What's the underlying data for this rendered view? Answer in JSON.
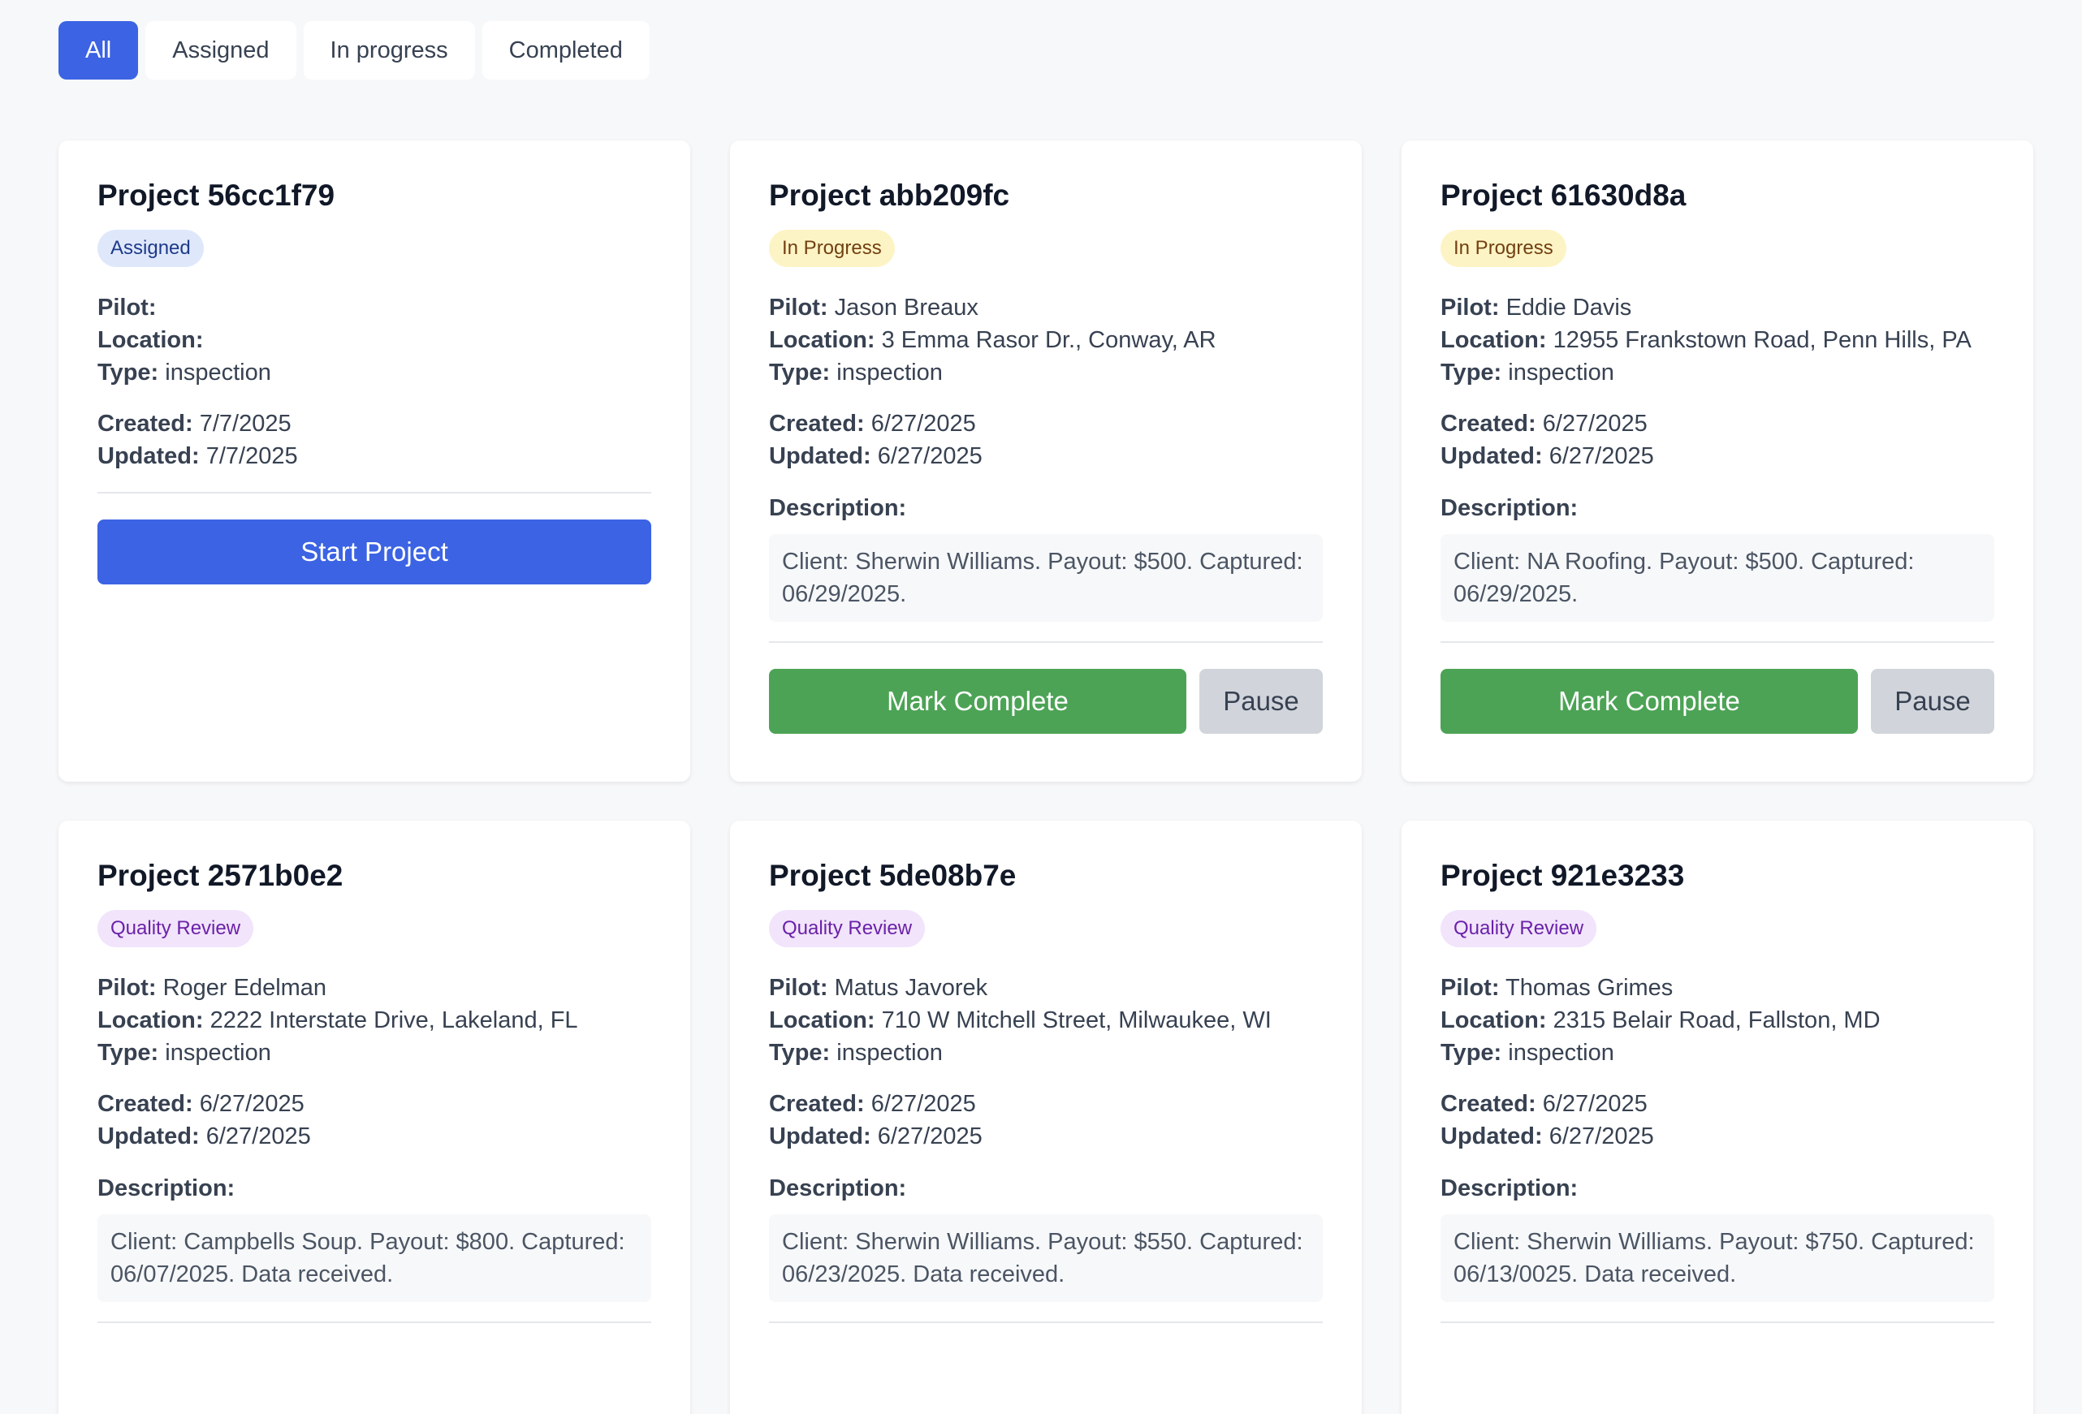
{
  "filters": [
    "All",
    "Assigned",
    "In progress",
    "Completed"
  ],
  "active_filter": "All",
  "labels": {
    "pilot": "Pilot:",
    "location": "Location:",
    "type": "Type:",
    "created": "Created:",
    "updated": "Updated:",
    "description": "Description:"
  },
  "projects": [
    {
      "title": "Project 56cc1f79",
      "status": "Assigned",
      "status_style": "assigned",
      "pilot": "",
      "location": "",
      "type": "inspection",
      "created": "7/7/2025",
      "updated": "7/7/2025",
      "description": "",
      "actions": [
        {
          "label": "Start Project",
          "style": "primary",
          "name": "start-project-button"
        }
      ]
    },
    {
      "title": "Project abb209fc",
      "status": "In Progress",
      "status_style": "inprogress",
      "pilot": "Jason Breaux",
      "location": "3 Emma Rasor Dr., Conway, AR",
      "type": "inspection",
      "created": "6/27/2025",
      "updated": "6/27/2025",
      "description": "Client: Sherwin Williams. Payout: $500. Captured: 06/29/2025.",
      "actions": [
        {
          "label": "Mark Complete",
          "style": "success",
          "name": "mark-complete-button"
        },
        {
          "label": "Pause",
          "style": "secondary",
          "name": "pause-button"
        }
      ]
    },
    {
      "title": "Project 61630d8a",
      "status": "In Progress",
      "status_style": "inprogress",
      "pilot": "Eddie Davis",
      "location": "12955 Frankstown Road, Penn Hills, PA",
      "type": "inspection",
      "created": "6/27/2025",
      "updated": "6/27/2025",
      "description": "Client: NA Roofing. Payout: $500. Captured: 06/29/2025.",
      "actions": [
        {
          "label": "Mark Complete",
          "style": "success",
          "name": "mark-complete-button"
        },
        {
          "label": "Pause",
          "style": "secondary",
          "name": "pause-button"
        }
      ]
    },
    {
      "title": "Project 2571b0e2",
      "status": "Quality Review",
      "status_style": "review",
      "pilot": "Roger Edelman",
      "location": "2222 Interstate Drive, Lakeland, FL",
      "type": "inspection",
      "created": "6/27/2025",
      "updated": "6/27/2025",
      "description": "Client: Campbells Soup. Payout: $800. Captured: 06/07/2025. Data received.",
      "actions": []
    },
    {
      "title": "Project 5de08b7e",
      "status": "Quality Review",
      "status_style": "review",
      "pilot": "Matus Javorek",
      "location": "710 W Mitchell Street, Milwaukee, WI",
      "type": "inspection",
      "created": "6/27/2025",
      "updated": "6/27/2025",
      "description": "Client: Sherwin Williams. Payout: $550. Captured: 06/23/2025. Data received.",
      "actions": []
    },
    {
      "title": "Project 921e3233",
      "status": "Quality Review",
      "status_style": "review",
      "pilot": "Thomas Grimes",
      "location": "2315 Belair Road, Fallston, MD",
      "type": "inspection",
      "created": "6/27/2025",
      "updated": "6/27/2025",
      "description": "Client: Sherwin Williams. Payout: $750. Captured: 06/13/0025. Data received.",
      "actions": []
    }
  ]
}
